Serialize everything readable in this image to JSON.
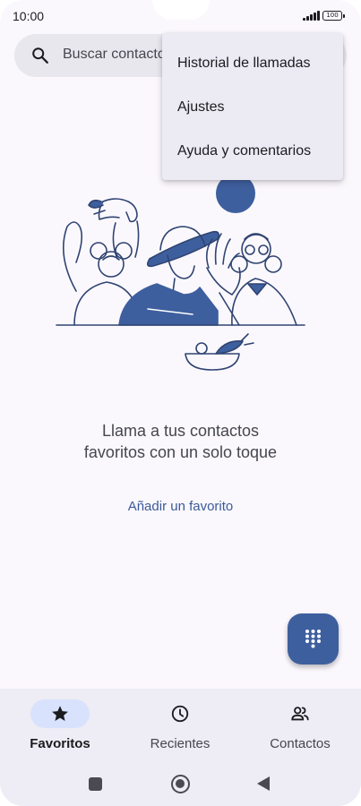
{
  "status_bar": {
    "time": "10:00",
    "battery": "100"
  },
  "search": {
    "placeholder": "Buscar contactos"
  },
  "menu": {
    "items": [
      {
        "label": "Historial de llamadas"
      },
      {
        "label": "Ajustes"
      },
      {
        "label": "Ayuda y comentarios"
      }
    ]
  },
  "empty_state": {
    "message": "Llama a tus contactos favoritos con un solo toque",
    "action": "Añadir un favorito"
  },
  "fab": {
    "icon": "dialpad-icon"
  },
  "bottom_nav": {
    "active": "favorites",
    "items": [
      {
        "label": "Favoritos",
        "icon": "star-icon"
      },
      {
        "label": "Recientes",
        "icon": "clock-icon"
      },
      {
        "label": "Contactos",
        "icon": "people-icon"
      }
    ]
  },
  "colors": {
    "accent": "#3e5f9e",
    "background": "#fbf8fd",
    "menu_background": "#eceaf3",
    "nav_background": "#eeecf4",
    "active_pill": "#d9e2fc"
  }
}
